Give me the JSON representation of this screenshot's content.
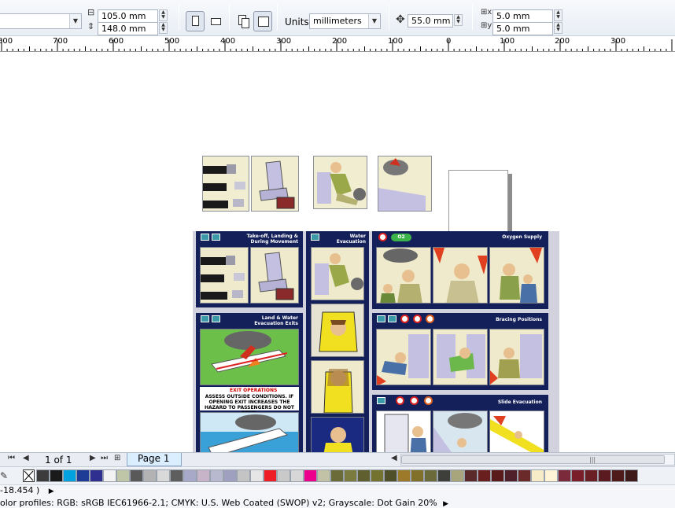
{
  "propbar": {
    "width_value": "105.0 mm",
    "height_value": "148.0 mm",
    "units_label": "Units:",
    "units_value": "millimeters",
    "nudge_value": "55.0 mm",
    "dup_x_value": "5.0 mm",
    "dup_y_value": "5.0 mm"
  },
  "ruler": {
    "labels": [
      "800",
      "700",
      "600",
      "500",
      "400",
      "300",
      "200",
      "100",
      "0",
      "100",
      "200",
      "300"
    ]
  },
  "panels": {
    "takeoff_title": "Take-off, Landing & During Movement",
    "water_title": "Water Evacuation",
    "oxygen_title": "Oxygen Supply",
    "exits_title": "Land & Water Evacuation Exits",
    "bracing_title": "Bracing Positions",
    "slide_title": "Slide Evacuation",
    "exit_warning_title": "EXIT OPERATIONS",
    "exit_warning_text": "ASSESS OUTSIDE CONDITIONS. IF OPENING EXIT INCREASES THE HAZARD TO PASSENGERS DO NOT OPEN.",
    "o2_label": "O2"
  },
  "pagebar": {
    "page_of": "1 of 1",
    "page_tab": "Page 1"
  },
  "palette": {
    "colors": [
      "#3c3c3c",
      "#1a1a1a",
      "#00a3e0",
      "#1e3c96",
      "#2f2f8f",
      "#f2f2f2",
      "#bfc6a8",
      "#595959",
      "#b3b3b3",
      "#d9d9d9",
      "#5e5e5e",
      "#a8a8c8",
      "#c8b4c8",
      "#b8b8cf",
      "#9fa0c0",
      "#c4c4c4",
      "#e6e6e6",
      "#ee1c24",
      "#c9c9c9",
      "#d7d7d7",
      "#ec008c",
      "#c2c2a6",
      "#6b6b3a",
      "#7b7a3f",
      "#5f5f2f",
      "#73732f",
      "#4f4f2a",
      "#9c7a2a",
      "#80702a",
      "#6a6a3a",
      "#3e3e3a",
      "#a8a47c",
      "#5a2a2a",
      "#6a1f1f",
      "#5a1a1a",
      "#4f1f2a",
      "#6a2a2a",
      "#f7ecc8",
      "#fff5d6",
      "#7a2a3a",
      "#7a1f2a",
      "#6a1f25",
      "#5a1a20",
      "#4f1a1a",
      "#3f1a1a"
    ]
  },
  "status": {
    "coords": "-18.454 )",
    "profiles": "olor profiles: RGB: sRGB IEC61966-2.1; CMYK: U.S. Web Coated (SWOP) v2; Grayscale: Dot Gain 20%"
  }
}
